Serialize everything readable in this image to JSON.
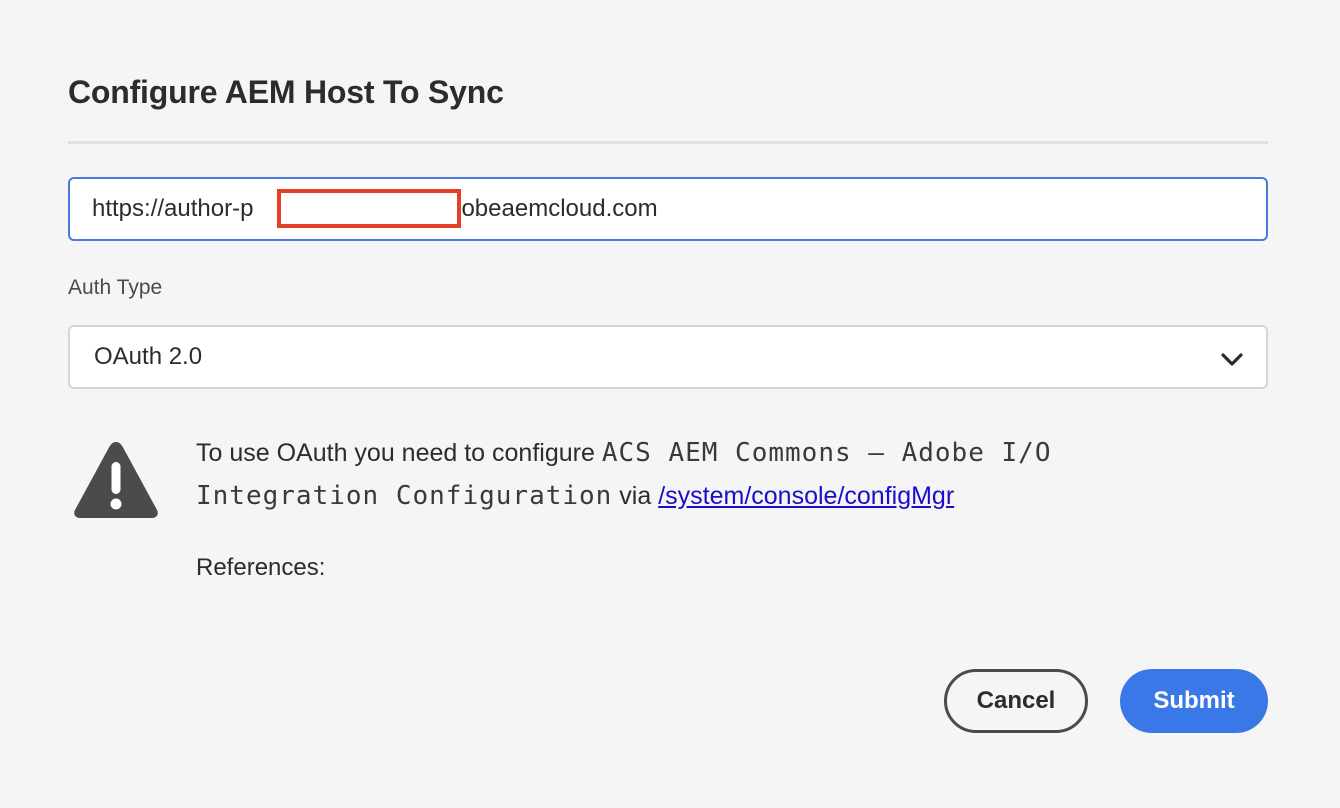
{
  "dialog": {
    "title": "Configure AEM Host To Sync"
  },
  "host": {
    "value": "https://author-p        .adobeaemcloud.com"
  },
  "auth": {
    "label": "Auth Type",
    "selected": "OAuth 2.0"
  },
  "warning": {
    "icon": "warning-triangle-icon",
    "text_before": "To use OAuth you need to configure ",
    "code": "ACS AEM Commons – Adobe I/O Integration Configuration",
    "text_via": " via ",
    "link": "/system/console/configMgr"
  },
  "references": {
    "label": "References:"
  },
  "buttons": {
    "cancel": "Cancel",
    "submit": "Submit"
  },
  "colors": {
    "accent": "#3b78e7",
    "focus_border": "#4a7ae0",
    "redaction": "#e34127",
    "link": "#1a0dcc"
  }
}
